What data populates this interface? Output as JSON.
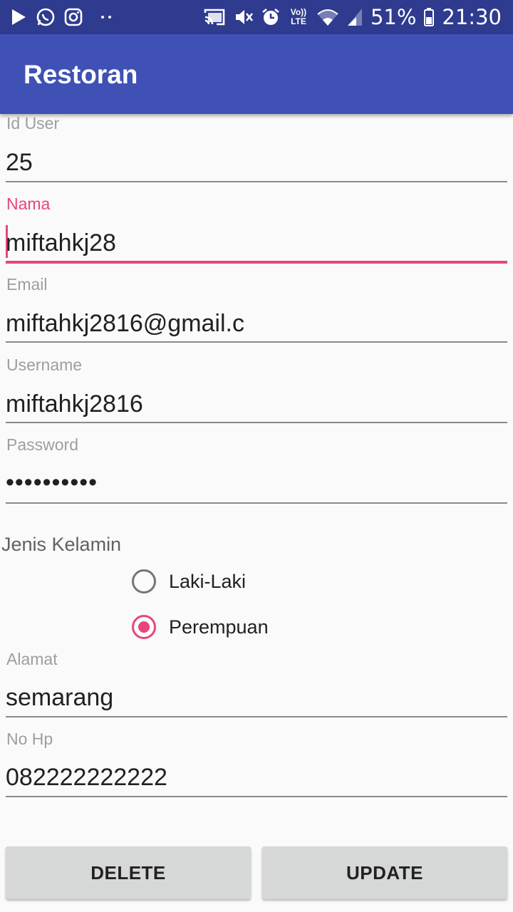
{
  "status_bar": {
    "icons_left": [
      "play-icon",
      "whatsapp-icon",
      "instagram-icon",
      "more-dots-icon"
    ],
    "icons_right": [
      "cast-icon",
      "mute-icon",
      "alarm-icon",
      "volte-icon",
      "wifi-icon",
      "signal-icon",
      "battery-icon"
    ],
    "volte_text": "Vo)) LTE",
    "battery": "51%",
    "time": "21:30"
  },
  "app_bar": {
    "title": "Restoran"
  },
  "form": {
    "id_user": {
      "label": "Id User",
      "value": "25"
    },
    "nama": {
      "label": "Nama",
      "value": "miftahkj28"
    },
    "email": {
      "label": "Email",
      "value": "miftahkj2816@gmail.c"
    },
    "username": {
      "label": "Username",
      "value": "miftahkj2816"
    },
    "password": {
      "label": "Password",
      "value": "••••••••••"
    },
    "jenis_kelamin": {
      "label": "Jenis Kelamin",
      "options": [
        "Laki-Laki",
        "Perempuan"
      ],
      "selected": "Perempuan"
    },
    "alamat": {
      "label": "Alamat",
      "value": "semarang"
    },
    "no_hp": {
      "label": "No Hp",
      "value": "082222222222"
    }
  },
  "buttons": {
    "delete": "DELETE",
    "update": "UPDATE"
  },
  "colors": {
    "primary": "#3f51b5",
    "primary_dark": "#2f3b8f",
    "accent": "#e8467a",
    "button_bg": "#d6d7d7"
  }
}
